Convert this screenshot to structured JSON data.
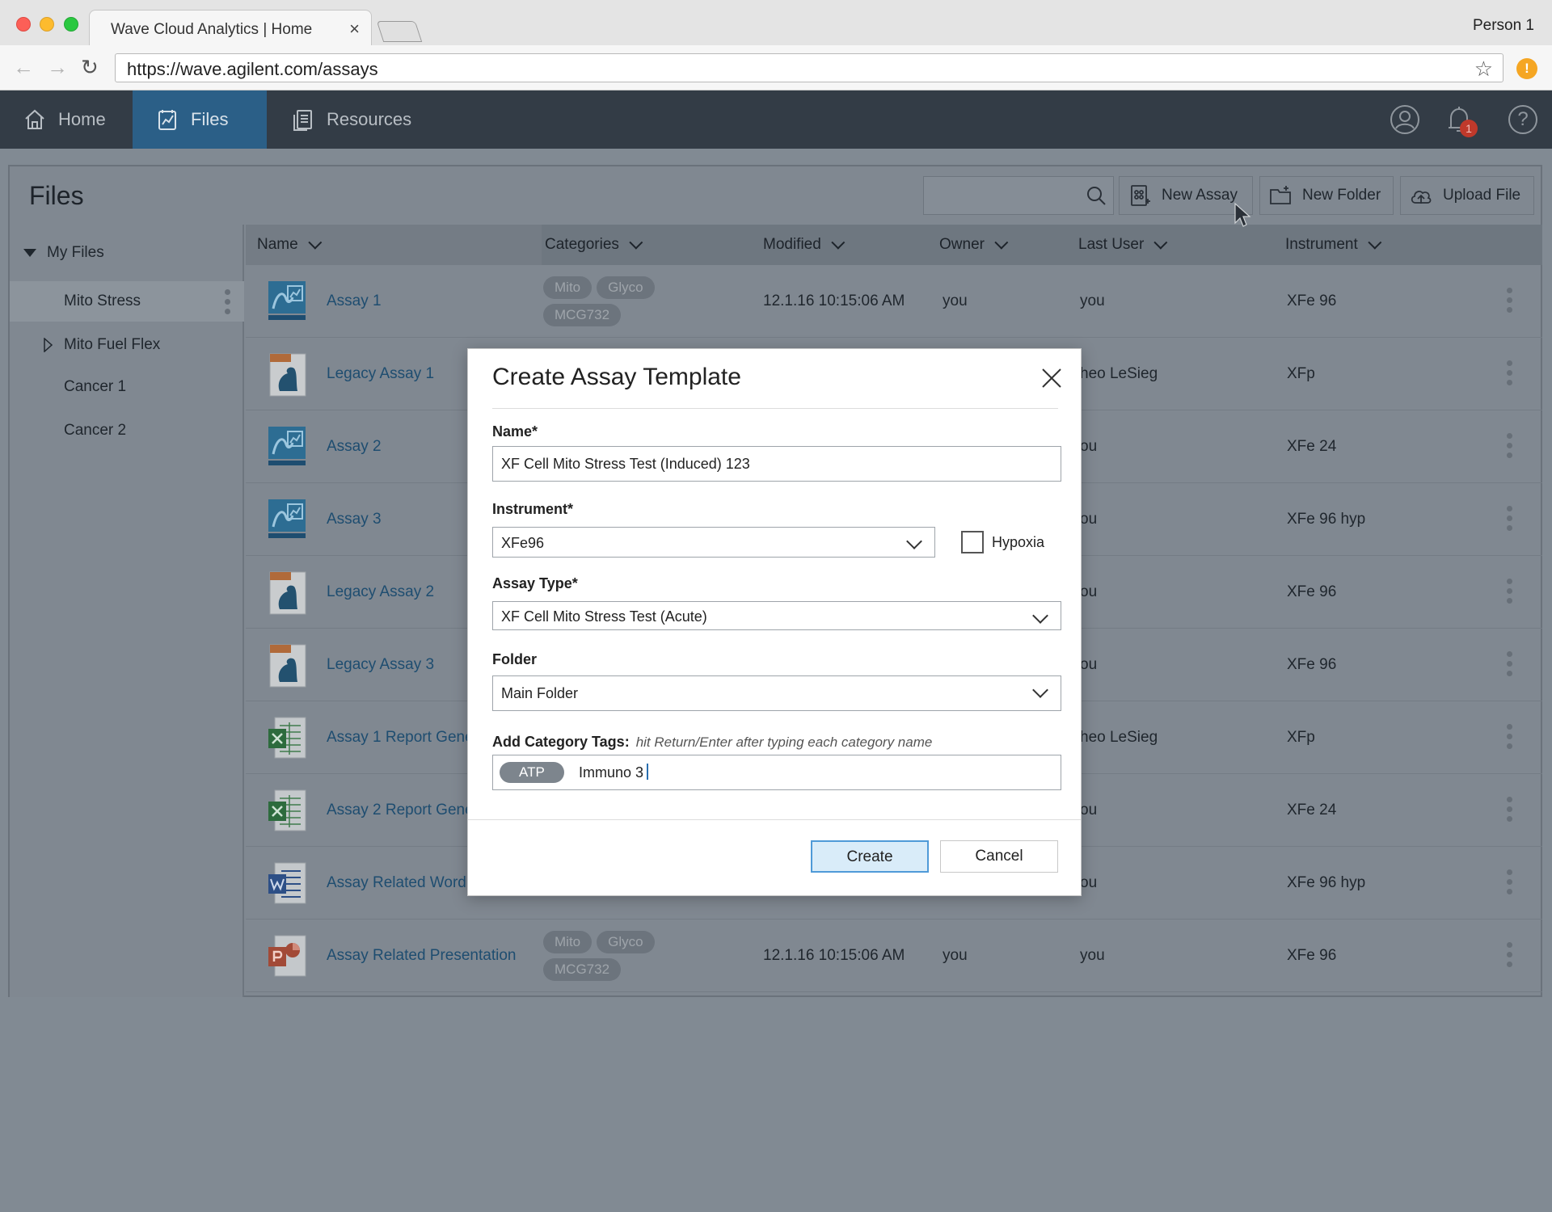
{
  "browser": {
    "tab_title": "Wave Cloud Analytics | Home",
    "tab_close": "×",
    "profile": "Person 1",
    "url": "https://wave.agilent.com/assays",
    "alert": "!"
  },
  "nav": {
    "items": [
      {
        "label": "Home"
      },
      {
        "label": "Files"
      },
      {
        "label": "Resources"
      }
    ],
    "notification_count": "1",
    "help": "?"
  },
  "files": {
    "title": "Files",
    "search": {
      "placeholder": ""
    },
    "actions": {
      "new_assay": "New Assay",
      "new_folder": "New Folder",
      "upload_file": "Upload File"
    },
    "sidebar": {
      "root": "My Files",
      "items": [
        {
          "label": "Mito Stress"
        },
        {
          "label": "Mito Fuel Flex"
        },
        {
          "label": "Cancer 1"
        },
        {
          "label": "Cancer 2"
        }
      ]
    },
    "columns": {
      "name": "Name",
      "categories": "Categories",
      "modified": "Modified",
      "owner": "Owner",
      "last_user": "Last User",
      "instrument": "Instrument"
    },
    "rows": [
      {
        "name": "Assay 1",
        "icon": "assay-icon",
        "tags": [
          "Mito",
          "Glyco",
          "MCG732"
        ],
        "modified": "12.1.16  10:15:06 AM",
        "owner": "you",
        "last_user": "you",
        "instrument": "XFe 96"
      },
      {
        "name": "Legacy Assay 1",
        "icon": "legacy-assay-icon",
        "tags": [],
        "modified": "",
        "owner": "",
        "last_user": "heo LeSieg",
        "instrument": "XFp"
      },
      {
        "name": "Assay 2",
        "icon": "assay-icon",
        "tags": [],
        "modified": "",
        "owner": "",
        "last_user": "ou",
        "instrument": "XFe 24"
      },
      {
        "name": "Assay 3",
        "icon": "assay-icon",
        "tags": [],
        "modified": "",
        "owner": "",
        "last_user": "ou",
        "instrument": "XFe 96 hyp"
      },
      {
        "name": "Legacy Assay 2",
        "icon": "legacy-assay-icon",
        "tags": [],
        "modified": "",
        "owner": "",
        "last_user": "ou",
        "instrument": "XFe 96"
      },
      {
        "name": "Legacy Assay 3",
        "icon": "legacy-assay-icon",
        "tags": [],
        "modified": "",
        "owner": "",
        "last_user": "ou",
        "instrument": "XFe 96"
      },
      {
        "name": "Assay 1 Report Gene",
        "icon": "excel-file-icon",
        "tags": [],
        "modified": "",
        "owner": "",
        "last_user": "heo LeSieg",
        "instrument": "XFp"
      },
      {
        "name": "Assay 2 Report Gene",
        "icon": "excel-file-icon",
        "tags": [],
        "modified": "",
        "owner": "",
        "last_user": "ou",
        "instrument": "XFe 24"
      },
      {
        "name": "Assay Related Word",
        "icon": "word-file-icon",
        "tags": [],
        "modified": "",
        "owner": "",
        "last_user": "ou",
        "instrument": "XFe 96 hyp"
      },
      {
        "name": "Assay Related Presentation",
        "icon": "powerpoint-file-icon",
        "tags": [
          "Mito",
          "Glyco",
          "MCG732"
        ],
        "modified": "12.1.16  10:15:06 AM",
        "owner": "you",
        "last_user": "you",
        "instrument": "XFe 96"
      }
    ]
  },
  "modal": {
    "title": "Create Assay Template",
    "name_label": "Name*",
    "name_value": "XF Cell Mito Stress Test (Induced) 123",
    "instrument_label": "Instrument*",
    "instrument_value": "XFe96",
    "hypoxia_label": "Hypoxia",
    "hypoxia_checked": false,
    "assay_type_label": "Assay Type*",
    "assay_type_value": "XF Cell Mito Stress Test (Acute)",
    "folder_label": "Folder",
    "folder_value": "Main Folder",
    "tags_label": "Add Category Tags:",
    "tags_hint": "hit Return/Enter after typing each category name",
    "tags": [
      "ATP"
    ],
    "tags_typed": "Immuno 3",
    "create_label": "Create",
    "cancel_label": "Cancel"
  },
  "colors": {
    "nav_bg": "#333c46",
    "nav_active": "#2b5f87",
    "link": "#1e4d70",
    "primary_button": "#d9ecf9",
    "overlay": "#818a93"
  }
}
